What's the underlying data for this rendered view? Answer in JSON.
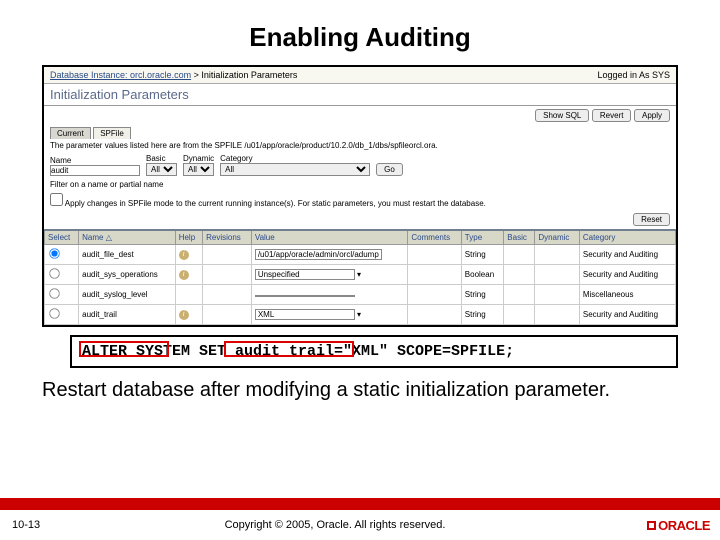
{
  "title": "Enabling Auditing",
  "breadcrumb_a": "Database Instance: orcl.oracle.com",
  "breadcrumb_sep": ">",
  "breadcrumb_b": "Initialization Parameters",
  "login": "Logged in As SYS",
  "section": "Initialization Parameters",
  "buttons": {
    "show": "Show SQL",
    "revert": "Revert",
    "apply": "Apply",
    "go": "Go",
    "reset": "Reset"
  },
  "tabs": {
    "current": "Current",
    "spfile": "SPFile"
  },
  "spfile_info": "The parameter values listed here are from the SPFILE /u01/app/oracle/product/10.2.0/db_1/dbs/spfileorcl.ora.",
  "filter": {
    "name_label": "Name",
    "name_value": "audit",
    "basic_label": "Basic",
    "dynamic_label": "Dynamic",
    "category_label": "Category",
    "all": "All"
  },
  "filter_hint": "Filter on a name or partial name",
  "apply_changes": "Apply changes in SPFile mode to the current running instance(s). For static parameters, you must restart the database.",
  "cols": {
    "select": "Select",
    "name": "Name",
    "help": "Help",
    "rev": "Revisions",
    "value": "Value",
    "comments": "Comments",
    "type": "Type",
    "basic": "Basic",
    "dynamic": "Dynamic",
    "category": "Category"
  },
  "rows": [
    {
      "name": "audit_file_dest",
      "value": "/u01/app/oracle/admin/orcl/adump",
      "type": "String",
      "dyn": "",
      "cat": "Security and Auditing"
    },
    {
      "name": "audit_sys_operations",
      "value": "Unspecified",
      "type": "Boolean",
      "dyn": "",
      "cat": "Security and Auditing"
    },
    {
      "name": "audit_syslog_level",
      "value": "",
      "type": "String",
      "dyn": "",
      "cat": "Miscellaneous"
    },
    {
      "name": "audit_trail",
      "value": "XML",
      "type": "String",
      "dyn": "",
      "cat": "Security and Auditing"
    }
  ],
  "sql": "ALTER SYSTEM SET audit_trail=\"XML\" SCOPE=SPFILE;",
  "instruction": "Restart database after modifying a static initialization parameter.",
  "slide_num": "10-13",
  "copyright": "Copyright © 2005, Oracle. All rights reserved.",
  "logo": "ORACLE"
}
